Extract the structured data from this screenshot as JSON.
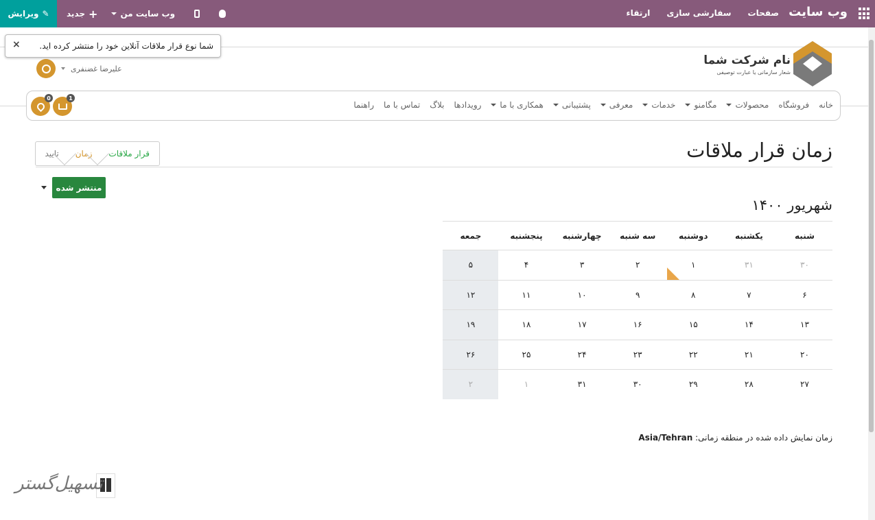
{
  "admin_bar": {
    "brand": "وب سایت",
    "menu": [
      "صفحات",
      "سفارشی سازی",
      "ارتقاء"
    ],
    "edit_label": "ویرایش",
    "new_label": "جدید",
    "my_site_label": "وب سایت من",
    "bg_color": "#875a7b",
    "edit_color": "#00a09d"
  },
  "toast": {
    "message": "شما نوع قرار ملاقات آنلاین خود را منتشر کرده اید.",
    "close": "×"
  },
  "header": {
    "company_name": "نام شرکت شما",
    "slogan": "شعار سازمانی یا عبارت توصیفی",
    "user_name": "علیرضا غضنفری"
  },
  "nav": {
    "items": [
      {
        "label": "خانه",
        "dropdown": false
      },
      {
        "label": "فروشگاه",
        "dropdown": false
      },
      {
        "label": "محصولات",
        "dropdown": true
      },
      {
        "label": "مگامنو",
        "dropdown": true
      },
      {
        "label": "خدمات",
        "dropdown": true
      },
      {
        "label": "معرفی",
        "dropdown": true
      },
      {
        "label": "پشتیبانی",
        "dropdown": true
      },
      {
        "label": "همکاری با ما",
        "dropdown": true
      },
      {
        "label": "رویدادها",
        "dropdown": false
      },
      {
        "label": "بلاگ",
        "dropdown": false
      },
      {
        "label": "تماس با ما",
        "dropdown": false
      },
      {
        "label": "راهنما",
        "dropdown": false
      }
    ],
    "cart_count": "1",
    "wishlist_count": "0"
  },
  "page": {
    "title": "زمان قرار ملاقات",
    "steps": [
      "قرار ملاقات",
      "زمان",
      "تایید"
    ],
    "publish_label": "منتشر شده"
  },
  "calendar": {
    "month": "شهریور ۱۴۰۰",
    "weekdays": [
      "شنبه",
      "یکشنبه",
      "دوشنبه",
      "سه شنبه",
      "چهارشنبه",
      "پنجشنبه",
      "جمعه"
    ],
    "weeks": [
      [
        "۳۰",
        "۳۱",
        "۱",
        "۲",
        "۳",
        "۴",
        "۵"
      ],
      [
        "۶",
        "۷",
        "۸",
        "۹",
        "۱۰",
        "۱۱",
        "۱۲"
      ],
      [
        "۱۳",
        "۱۴",
        "۱۵",
        "۱۶",
        "۱۷",
        "۱۸",
        "۱۹"
      ],
      [
        "۲۰",
        "۲۱",
        "۲۲",
        "۲۳",
        "۲۴",
        "۲۵",
        "۲۶"
      ],
      [
        "۲۷",
        "۲۸",
        "۲۹",
        "۳۰",
        "۳۱",
        "۱",
        "۲"
      ]
    ],
    "muted": [
      [
        0,
        0
      ],
      [
        0,
        1
      ],
      [
        4,
        5
      ],
      [
        4,
        6
      ]
    ],
    "highlight": [
      0,
      2
    ],
    "highlight_color": "#e9a64a"
  },
  "timezone": {
    "label": "زمان نمایش داده شده در منطقه زمانی:",
    "value": "Asia/Tehran"
  },
  "watermark": {
    "text": "تسهیل‌گستر"
  }
}
